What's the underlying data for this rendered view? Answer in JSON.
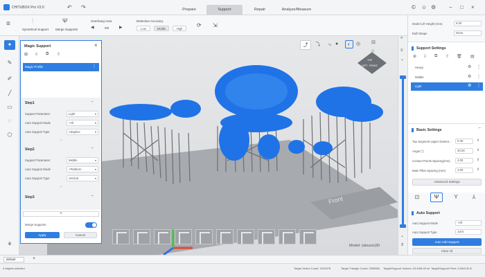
{
  "app": {
    "title": "CHITUBOX Pro V2.0"
  },
  "tabs": [
    {
      "label": "Prepare",
      "active": false
    },
    {
      "label": "Support",
      "active": true
    },
    {
      "label": "Repair",
      "active": false
    },
    {
      "label": "Analyze/Measure",
      "active": false
    }
  ],
  "toolbar": {
    "symmetrical_support": "Symetrical Support",
    "merge_supports": "Merge Supports",
    "overhang_label": "Overhang Area",
    "overhang_count": "0/0",
    "detection_label": "Detection Accuracy",
    "detection_options": [
      "Low",
      "Middle",
      "High"
    ],
    "detection_selected": "Middle"
  },
  "magic": {
    "title": "Magic Support",
    "profile": "Magic Profile",
    "steps": [
      {
        "title": "Step1",
        "rows": [
          {
            "label": "Support Parameter",
            "value": "Light"
          },
          {
            "label": "Auto Support Mode",
            "value": "+All"
          },
          {
            "label": "Auto Support Type",
            "value": "Adaptive"
          }
        ]
      },
      {
        "title": "Step2",
        "rows": [
          {
            "label": "Support Parameter",
            "value": "Middle"
          },
          {
            "label": "Auto Support Mode",
            "value": "+Platform"
          },
          {
            "label": "Auto Support Type",
            "value": "Vertical"
          }
        ]
      },
      {
        "title": "Step3",
        "rows": []
      }
    ],
    "merge_label": "Merge Supports",
    "merge_on": true,
    "apply": "Apply",
    "cancel": "Cancel"
  },
  "right": {
    "lift_label": "Model Lift Height (mm)",
    "lift_value": "5.00",
    "raft_label": "Raft Shape",
    "raft_value": "None",
    "support_settings": "Support Settings",
    "profiles": [
      "Heavy",
      "Middle",
      "Light"
    ],
    "profile_selected": "Light",
    "basic_settings": "Basic Settings",
    "params": [
      {
        "label": "Top Segment Upper Diamet...",
        "value": "0.30"
      },
      {
        "label": "Angle (°)",
        "value": "40.00"
      },
      {
        "label": "Contact Points Spacing(mm)",
        "value": "4.00"
      },
      {
        "label": "Main Pillar Spacing (mm)",
        "value": "4.00"
      }
    ],
    "advanced": "Advanced Settings",
    "auto_support": "Auto Support",
    "auto_mode_label": "Auto Support Mode",
    "auto_mode_value": "+All",
    "auto_type_label": "Auto Support Type",
    "auto_type_value": "Joint",
    "auto_add": "Auto Add Support",
    "clear_all": "Clear All"
  },
  "viewport": {
    "model_label": "Model: (alouxe)30",
    "front_label": "Front",
    "cube_labels": [
      "TOP",
      "FRONT",
      "LEFT"
    ]
  },
  "bottom": {
    "plate_tab": "default",
    "add": "+"
  },
  "status": {
    "selected": "4 targets selected",
    "vertex": "Target Vertex Count: 1043978",
    "triangle": "Target Triangle Count: 2055860",
    "volume": "Target/Support Volume: 29.64/8.99 ml",
    "price": "Target/Support Price: 0.98/0.30 $"
  },
  "colors": {
    "accent": "#2f7de1",
    "model": "#1f73e6",
    "support": "#6b6e73"
  }
}
